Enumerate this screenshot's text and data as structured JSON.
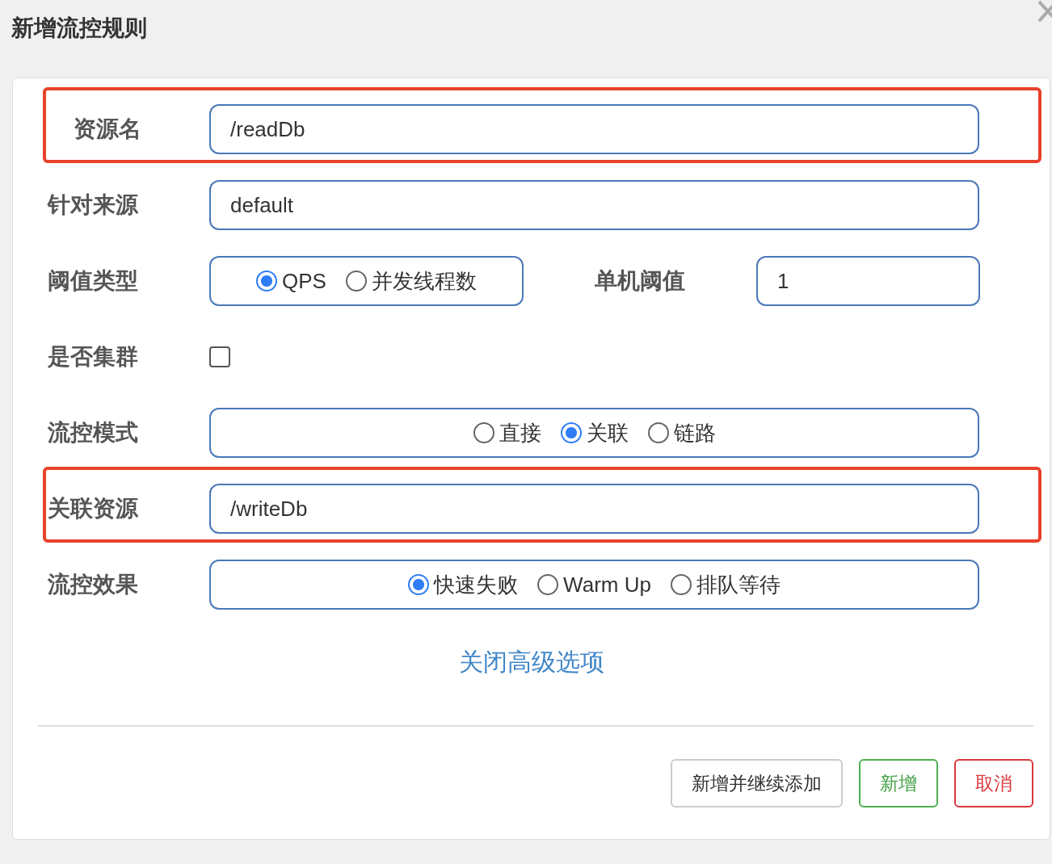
{
  "dialog": {
    "title": "新增流控规则"
  },
  "rows": [
    {
      "kind": "input",
      "label": "资源名",
      "value": "/readDb",
      "highlighted": true
    },
    {
      "kind": "input",
      "label": "针对来源",
      "value": "default",
      "highlighted": false
    },
    {
      "kind": "radio_pair",
      "label": "阈值类型",
      "options": [
        {
          "label": "QPS",
          "selected": true
        },
        {
          "label": "并发线程数",
          "selected": false
        }
      ],
      "second_label": "单机阈值",
      "second_value": "1",
      "highlighted": false
    },
    {
      "kind": "checkbox",
      "label": "是否集群",
      "checked": false,
      "highlighted": false
    },
    {
      "kind": "radio",
      "label": "流控模式",
      "options": [
        {
          "label": "直接",
          "selected": false
        },
        {
          "label": "关联",
          "selected": true
        },
        {
          "label": "链路",
          "selected": false
        }
      ],
      "highlighted": false
    },
    {
      "kind": "input",
      "label": "关联资源",
      "value": "/writeDb",
      "highlighted": true
    },
    {
      "kind": "radio",
      "label": "流控效果",
      "options": [
        {
          "label": "快速失败",
          "selected": true
        },
        {
          "label": "Warm Up",
          "selected": false
        },
        {
          "label": "排队等待",
          "selected": false
        }
      ],
      "highlighted": false
    }
  ],
  "advanced_link": "关闭高级选项",
  "buttons": [
    {
      "label": "新增并继续添加",
      "kind": "default"
    },
    {
      "label": "新增",
      "kind": "success"
    },
    {
      "label": "取消",
      "kind": "danger"
    }
  ]
}
